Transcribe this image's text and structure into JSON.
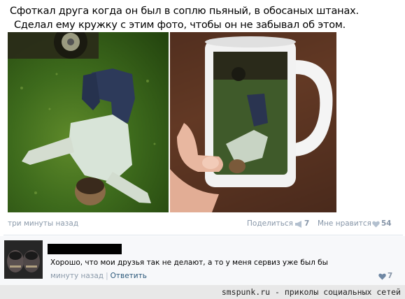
{
  "post": {
    "text_line1": "Сфоткал друга когда он был в соплю пьяный, в обосаных штанах.",
    "text_line2": "Сделал ему кружку с этим фото, чтобы он не забывал об этом.",
    "timestamp": "три минуты назад",
    "share_label": "Поделиться",
    "share_count": "7",
    "like_label": "Мне нравится",
    "like_count": "54"
  },
  "comment": {
    "text": "Хорошо, что мои друзья так не делают, а то у меня сервиз уже был бы",
    "time": "минуту назад",
    "separator": "|",
    "reply_label": "Ответить",
    "like_count": "7"
  },
  "footer": {
    "watermark": "smspunk.ru - приколы социальных сетей"
  },
  "colors": {
    "link": "#2b587a",
    "meta": "#8796a8"
  }
}
